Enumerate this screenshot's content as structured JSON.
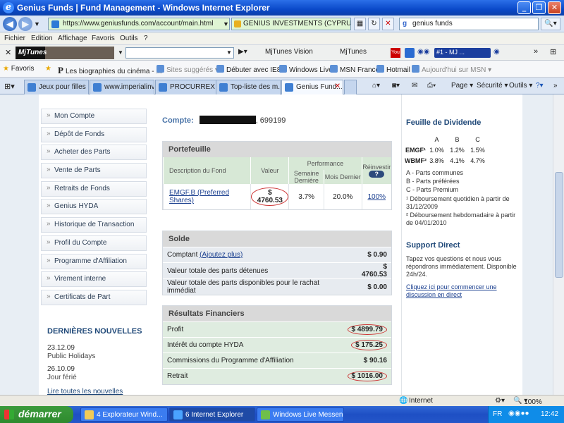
{
  "window": {
    "title": "Genius Funds | Fund Management - Windows Internet Explorer"
  },
  "address": {
    "url": "https://www.geniusfunds.com/account/main.html",
    "cert": "GENIUS INVESTMENTS (CYPRUS) LTD ...",
    "search": "genius funds"
  },
  "menu": [
    "Fichier",
    "Edition",
    "Affichage",
    "Favoris",
    "Outils",
    "?"
  ],
  "toolbar": {
    "mjtunes_logo": "MjTunes",
    "vision": "MjTunes Vision",
    "mjtunes": "MjTunes",
    "radio": "#1 - MJ ..."
  },
  "favorites": {
    "label": "Favoris",
    "items": [
      "Les biographies du cinéma - ...",
      "Sites suggérés",
      "Débuter avec IE8",
      "Windows Live",
      "MSN France",
      "Hotmail",
      "Aujourd'hui sur MSN"
    ]
  },
  "tabs": [
    "Jeux pour filles ...",
    "www.imperialinv...",
    "PROCURREX E-...",
    "Top-liste des m...",
    "Genius Fund..."
  ],
  "tab_commands": {
    "page": "Page",
    "security": "Sécurité",
    "tools": "Outils"
  },
  "sidebar": {
    "items": [
      "Mon Compte",
      "Dépôt de Fonds",
      "Acheter des Parts",
      "Vente de Parts",
      "Retraits de Fonds",
      "Genius HYDA",
      "Historique de Transaction",
      "Profil du Compte",
      "Programme d'Affiliation",
      "Virement interne",
      "Certificats de Part"
    ],
    "news_heading": "DERNIÈRES NOUVELLES",
    "news": [
      {
        "date": "23.12.09",
        "title": "Public Holidays"
      },
      {
        "date": "26.10.09",
        "title": "Jour férié"
      }
    ],
    "more": "Lire toutes les nouvelles"
  },
  "account": {
    "label": "Compte:",
    "number": ", 699199"
  },
  "portfolio": {
    "heading": "Portefeuille",
    "col_desc": "Description du Fond",
    "col_value": "Valeur",
    "col_perf": "Performance",
    "col_week": "Semaine Dernière",
    "col_month": "Mois Dernier",
    "col_reinvest": "Réinvestir",
    "help": "?",
    "fund": "EMGF.B (Preferred Shares)",
    "value": "$ 4760.53",
    "week": "3.7%",
    "month": "20.0%",
    "reinvest": "100%"
  },
  "balance": {
    "heading": "Solde",
    "rows": [
      {
        "label": "Comptant",
        "link": "(Ajoutez plus)",
        "value": "$ 0.90"
      },
      {
        "label": "Valeur totale des parts détenues",
        "value": "$ 4760.53"
      },
      {
        "label": "Valeur totale des parts disponibles pour le rachat immédiat",
        "value": "$ 0.00"
      }
    ]
  },
  "results": {
    "heading": "Résultats Financiers",
    "rows": [
      {
        "label": "Profit",
        "value": "$ 4899.79"
      },
      {
        "label": "Intérêt du compte HYDA",
        "value": "$ 175.25"
      },
      {
        "label": "Commissions du Programme d'Affiliation",
        "value": "$ 90.16"
      },
      {
        "label": "Retrait",
        "value": "$ 1016.00"
      }
    ]
  },
  "dividend": {
    "heading": "Feuille de Dividende",
    "cols": [
      "A",
      "B",
      "C"
    ],
    "rows": [
      {
        "name": "EMGF¹",
        "a": "1.0%",
        "b": "1.2%",
        "c": "1.5%"
      },
      {
        "name": "WBMF²",
        "a": "3.8%",
        "b": "4.1%",
        "c": "4.7%"
      }
    ],
    "legend_a": "A - Parts communes",
    "legend_b": "B - Parts préférées",
    "legend_c": "C - Parts Premium",
    "note1": "¹ Déboursement quotidien à partir de 31/12/2009",
    "note2": "² Déboursement hebdomadaire à partir de 04/01/2010"
  },
  "support": {
    "heading": "Support Direct",
    "text": "Tapez vos questions et nous vous répondrons immédiatement. Disponible 24h/24.",
    "link": "Cliquez ici pour commencer une discussion en direct"
  },
  "status": {
    "zone": "Internet",
    "zoom": "100%"
  },
  "taskbar": {
    "start": "démarrer",
    "tasks": [
      "4 Explorateur Wind...",
      "6 Internet Explorer",
      "Windows Live Messen..."
    ],
    "lang": "FR",
    "clock": "12:42"
  }
}
